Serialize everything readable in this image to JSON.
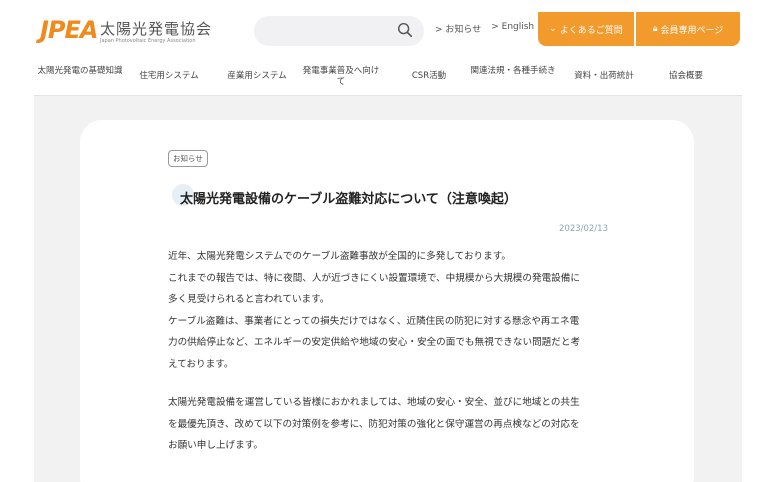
{
  "header": {
    "logo_mark": "JPEA",
    "logo_name": "太陽光発電協会",
    "logo_sub": "Japan Photovoltaic Energy Association",
    "search_icon": "search-icon",
    "top_links": [
      "お知らせ",
      "English"
    ],
    "faq_button": "よくあるご質問",
    "member_button": "会員専用ページ",
    "accent_color": "#f39a2c"
  },
  "nav": {
    "items": [
      "太陽光発電の基礎知識",
      "住宅用システム",
      "産業用システム",
      "発電事業普及へ向けて",
      "CSR活動",
      "関連法規・各種手続き",
      "資料・出荷統計",
      "協会概要"
    ]
  },
  "article": {
    "tag": "お知らせ",
    "title": "太陽光発電設備のケーブル盗難対応について（注意喚起）",
    "date": "2023/02/13",
    "paragraph1": [
      "近年、太陽光発電システムでのケーブル盗難事故が全国的に多発しております。",
      "これまでの報告では、特に夜間、人が近づきにくい設置環境で、中規模から大規模の発電設備に",
      "多く見受けられると言われています。",
      "ケーブル盗難は、事業者にとっての損失だけではなく、近隣住民の防犯に対する懸念や再エネ電",
      "力の供給停止など、エネルギーの安定供給や地域の安心・安全の面でも無視できない問題だと考",
      "えております。"
    ],
    "paragraph2": [
      "太陽光発電設備を運営している皆様におかれましては、地域の安心・安全、並びに地域との共生",
      "を最優先頂き、改めて以下の対策例を参考に、防犯対策の強化と保守運営の再点検などの対応を",
      "お願い申し上げます。"
    ]
  }
}
